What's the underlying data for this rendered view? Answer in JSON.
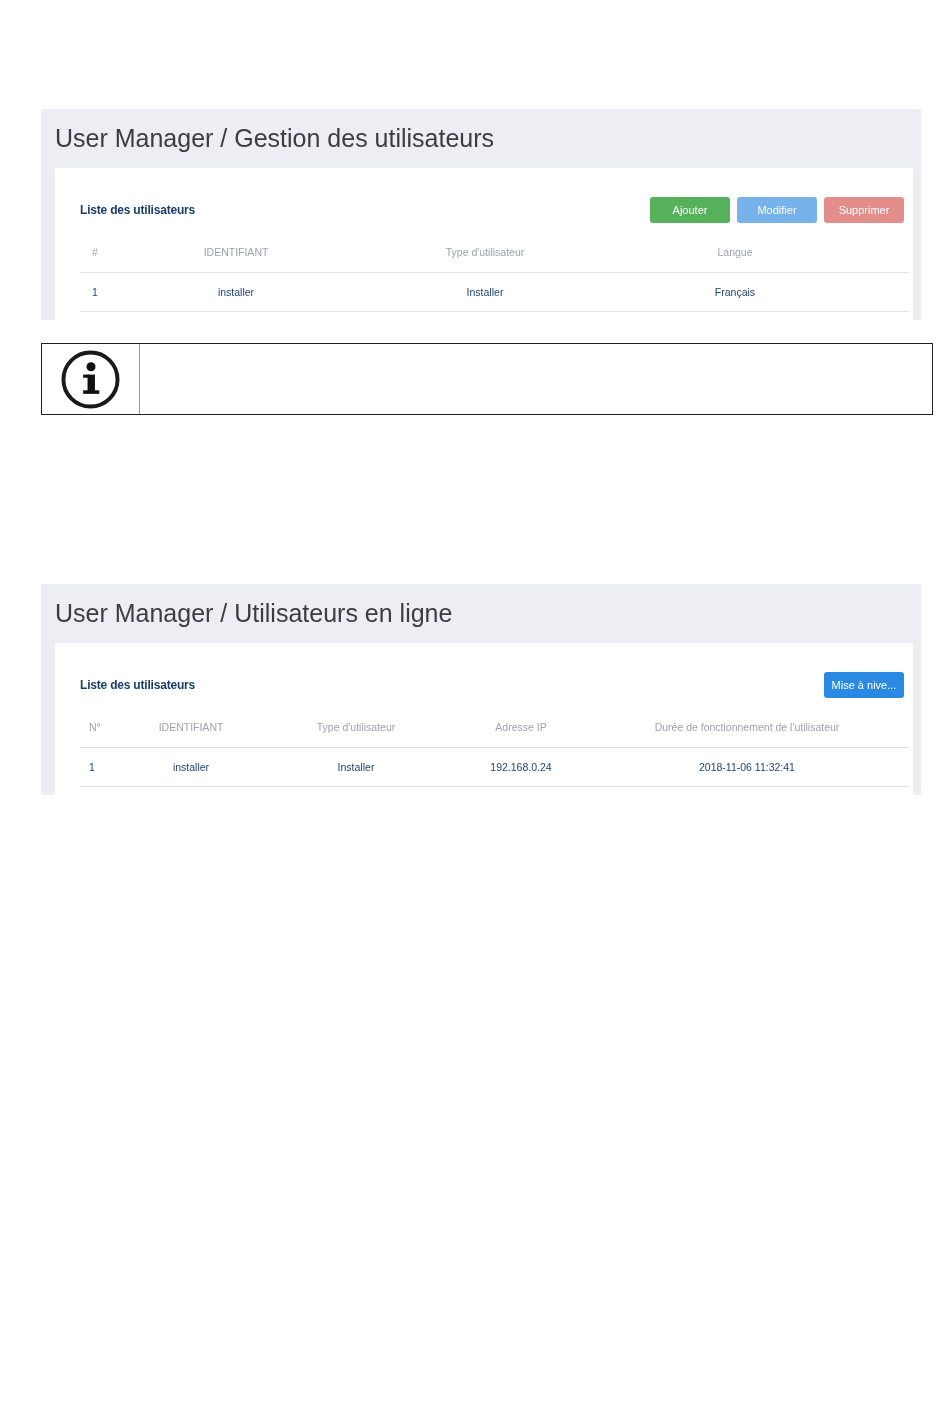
{
  "blocks": [
    {
      "kind": "panel",
      "title": "User Manager / Gestion des utilisateurs",
      "card": {
        "heading": "Liste des utilisateurs",
        "buttons": [
          {
            "label": "Ajouter",
            "kind": "add",
            "disabled": false
          },
          {
            "label": "Modifier",
            "kind": "edit",
            "disabled": true
          },
          {
            "label": "Supprimer",
            "kind": "delete",
            "disabled": true
          }
        ],
        "columns": [
          "#",
          "IDENTIFIANT",
          "Type d'utilisateur",
          "Langue"
        ],
        "rows": [
          [
            "1",
            "installer",
            "Installer",
            "Français"
          ]
        ]
      }
    },
    {
      "kind": "notice"
    },
    {
      "kind": "panel",
      "title": "User Manager / Utilisateurs en ligne",
      "card": {
        "heading": "Liste des utilisateurs",
        "buttons": [
          {
            "label": "Mise à nive...",
            "kind": "upgrade",
            "disabled": false
          }
        ],
        "columns": [
          "N°",
          "IDENTIFIANT",
          "Type d'utilisateur",
          "Adresse IP",
          "Durée de fonctionnement de l'utilisateur"
        ],
        "rows": [
          [
            "1",
            "installer",
            "Installer",
            "192.168.0.24",
            "2018-11-06 11:32:41"
          ]
        ]
      }
    }
  ]
}
